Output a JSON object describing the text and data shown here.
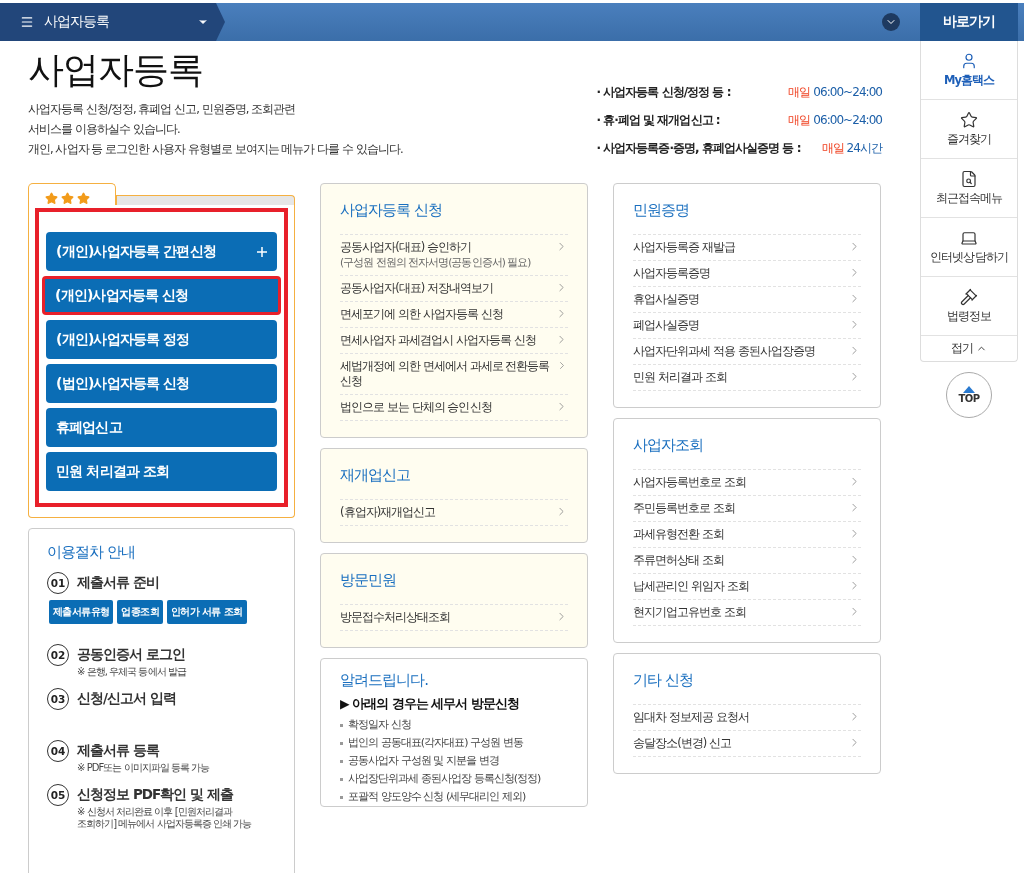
{
  "top_bar": {
    "title": "사업자등록",
    "quick_link": "바로가기"
  },
  "page": {
    "title": "사업자등록",
    "description": [
      "사업자등록 신청/정정, 휴폐업 신고, 민원증명, 조회관련",
      "서비스를 이용하실수 있습니다.",
      "개인, 사업자 등 로그인한 사용자 유형별로 보여지는 메뉴가 다를 수 있습니다."
    ]
  },
  "service_hours": [
    {
      "label": "· 사업자등록 신청/정정 등 :",
      "day": "매일",
      "hours": "06:00~24:00"
    },
    {
      "label": "· 휴·폐업 및 재개업신고 :",
      "day": "매일",
      "hours": "06:00~24:00"
    },
    {
      "label": "· 사업자등록증·증명, 휴폐업사실증명 등 :",
      "day": "매일",
      "hours": "24시간"
    }
  ],
  "quick_menu": {
    "stars": 3,
    "highlighted": true,
    "items": [
      {
        "label": "(개인)사업자등록 간편신청",
        "kind": "expandable",
        "highlighted": false
      },
      {
        "label": "(개인)사업자등록 신청",
        "kind": "plain",
        "highlighted": true
      },
      {
        "label": "(개인)사업자등록 정정",
        "kind": "plain",
        "highlighted": false
      },
      {
        "label": "(법인)사업자등록 신청",
        "kind": "plain",
        "highlighted": false
      },
      {
        "label": "휴폐업신고",
        "kind": "plain",
        "highlighted": false
      },
      {
        "label": "민원 처리결과 조회",
        "kind": "plain",
        "highlighted": false
      }
    ]
  },
  "procedure": {
    "title": "이용절차 안내",
    "steps": [
      {
        "number": "01",
        "title": "제출서류 준비",
        "buttons": [
          "제출서류유형",
          "업종조회",
          "인허가 서류 조회"
        ]
      },
      {
        "number": "02",
        "title": "공동인증서 로그인",
        "note": "※ 은행, 우체국 등에서 발급"
      },
      {
        "number": "03",
        "title": "신청/신고서 입력"
      },
      {
        "number": "04",
        "title": "제출서류 등록",
        "note": "※ PDF또는 이미지파일 등록 가능"
      },
      {
        "number": "05",
        "title": "신청정보 PDF확인 및 제출",
        "note": "※ 신청서 처리완료 이후 [민원처리결과\n조회하기] 메뉴에서 사업자등록증 인쇄 가능"
      }
    ]
  },
  "middle_cards": [
    {
      "title": "사업자등록 신청",
      "tinted": true,
      "items": [
        {
          "label": "공동사업자(대표) 승인하기",
          "sublabel": "(구성원 전원의 전자서명(공동인증서) 필요)"
        },
        {
          "label": "공동사업자(대표) 저장내역보기"
        },
        {
          "label": "면세포기에 의한 사업자등록 신청"
        },
        {
          "label": "면세사업자 과세겸업시 사업자등록 신청"
        },
        {
          "label": "세법개정에 의한 면세에서 과세로 전환등록 신청"
        },
        {
          "label": "법인으로 보는 단체의 승인신청"
        }
      ]
    },
    {
      "title": "재개업신고",
      "tinted": true,
      "items": [
        {
          "label": "(휴업자)재개업신고"
        }
      ]
    },
    {
      "title": "방문민원",
      "tinted": true,
      "items": [
        {
          "label": "방문접수처리상태조회"
        }
      ]
    }
  ],
  "notice": {
    "title": "알려드립니다.",
    "heading": "▶ 아래의 경우는 세무서 방문신청",
    "items": [
      "확정일자 신청",
      "법인의 공동대표(각자대표) 구성원 변동",
      "공동사업자 구성원 및 지분을 변경",
      "사업장단위과세 종된사업장 등록신청(정정)",
      "포괄적 양도양수 신청 (세무대리인 제외)"
    ]
  },
  "right_cards": [
    {
      "title": "민원증명",
      "tinted": false,
      "items": [
        {
          "label": "사업자등록증 재발급"
        },
        {
          "label": "사업자등록증명"
        },
        {
          "label": "휴업사실증명"
        },
        {
          "label": "폐업사실증명"
        },
        {
          "label": "사업자단위과세 적용 종된사업장증명"
        },
        {
          "label": "민원 처리결과 조회"
        }
      ]
    },
    {
      "title": "사업자조회",
      "tinted": false,
      "items": [
        {
          "label": "사업자등록번호로 조회"
        },
        {
          "label": "주민등록번호로 조회"
        },
        {
          "label": "과세유형전환 조회"
        },
        {
          "label": "주류면허상태 조회"
        },
        {
          "label": "납세관리인 위임자 조회"
        },
        {
          "label": "현지기업고유번호 조회"
        }
      ]
    },
    {
      "title": "기타 신청",
      "tinted": false,
      "items": [
        {
          "label": "임대차 정보제공 요청서"
        },
        {
          "label": "송달장소(변경) 신고"
        }
      ]
    }
  ],
  "side_menu": {
    "items": [
      {
        "label": "My홈택스",
        "selected": true
      },
      {
        "label": "즐겨찾기",
        "selected": false
      },
      {
        "label": "최근접속메뉴",
        "selected": false
      },
      {
        "label": "인터넷상담하기",
        "selected": false
      },
      {
        "label": "법령정보",
        "selected": false
      }
    ],
    "collapse": "접기",
    "top": "TOP"
  }
}
